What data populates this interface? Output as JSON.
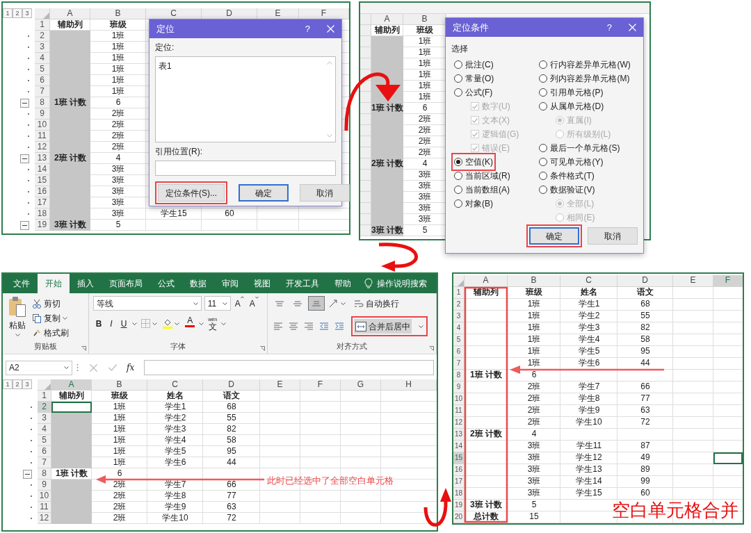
{
  "goto_panel": {
    "outline_levels": [
      "1",
      "2",
      "3"
    ],
    "columns": [
      "A",
      "B",
      "C",
      "D",
      "E",
      "F"
    ],
    "rows": [
      {
        "n": "1",
        "cells": [
          "辅助列",
          "班级"
        ],
        "shaded": false
      },
      {
        "n": "2",
        "cells": [
          "",
          "1班"
        ],
        "shaded": true,
        "group_end": false
      },
      {
        "n": "3",
        "cells": [
          "",
          "1班"
        ],
        "shaded": true,
        "group_end": false
      },
      {
        "n": "4",
        "cells": [
          "",
          "1班"
        ],
        "shaded": true,
        "group_end": false
      },
      {
        "n": "5",
        "cells": [
          "",
          "1班"
        ],
        "shaded": true,
        "group_end": false
      },
      {
        "n": "6",
        "cells": [
          "",
          "1班"
        ],
        "shaded": true,
        "group_end": false
      },
      {
        "n": "7",
        "cells": [
          "",
          "1班"
        ],
        "shaded": true,
        "group_end": false
      },
      {
        "n": "8",
        "cells": [
          "1班 计数",
          "6"
        ],
        "shaded": true,
        "group_end": true
      },
      {
        "n": "9",
        "cells": [
          "",
          "2班"
        ],
        "shaded": true,
        "group_end": false
      },
      {
        "n": "10",
        "cells": [
          "",
          "2班"
        ],
        "shaded": true,
        "group_end": false
      },
      {
        "n": "11",
        "cells": [
          "",
          "2班"
        ],
        "shaded": true,
        "group_end": false
      },
      {
        "n": "12",
        "cells": [
          "",
          "2班"
        ],
        "shaded": true,
        "group_end": false
      },
      {
        "n": "13",
        "cells": [
          "2班 计数",
          "4"
        ],
        "shaded": true,
        "group_end": true
      },
      {
        "n": "14",
        "cells": [
          "",
          "3班"
        ],
        "shaded": true,
        "group_end": false
      },
      {
        "n": "15",
        "cells": [
          "",
          "3班"
        ],
        "shaded": true,
        "group_end": false
      },
      {
        "n": "16",
        "cells": [
          "",
          "3班"
        ],
        "shaded": true,
        "group_end": false
      },
      {
        "n": "17",
        "cells": [
          "",
          "3班"
        ],
        "shaded": true,
        "group_end": false
      },
      {
        "n": "18",
        "cells": [
          "",
          "3班",
          "学生15",
          "60"
        ],
        "shaded": true,
        "group_end": false
      },
      {
        "n": "19",
        "cells": [
          "3班 计数",
          "5"
        ],
        "shaded": true,
        "group_end": true
      }
    ],
    "dialog": {
      "title": "定位",
      "help": "?",
      "location_label": "定位:",
      "list_items": [
        "表1"
      ],
      "reference_label": "引用位置(R):",
      "buttons": [
        {
          "label": "定位条件(S)...",
          "default": false,
          "highlighted": true
        },
        {
          "label": "确定",
          "default": true,
          "highlighted": false
        },
        {
          "label": "取消",
          "default": false,
          "highlighted": false
        }
      ]
    }
  },
  "special_panel": {
    "columns": [
      "A",
      "B"
    ],
    "rows": [
      {
        "cells": [
          "辅助列",
          "班级"
        ],
        "shaded": false
      },
      {
        "cells": [
          "",
          "1班"
        ],
        "shaded": true
      },
      {
        "cells": [
          "",
          "1班"
        ],
        "shaded": true
      },
      {
        "cells": [
          "",
          "1班"
        ],
        "shaded": true
      },
      {
        "cells": [
          "",
          "1班"
        ],
        "shaded": true
      },
      {
        "cells": [
          "",
          "1班"
        ],
        "shaded": true
      },
      {
        "cells": [
          "",
          "1班"
        ],
        "shaded": true
      },
      {
        "cells": [
          "1班 计数",
          "6"
        ],
        "shaded": true
      },
      {
        "cells": [
          "",
          "2班"
        ],
        "shaded": true
      },
      {
        "cells": [
          "",
          "2班"
        ],
        "shaded": true
      },
      {
        "cells": [
          "",
          "2班"
        ],
        "shaded": true
      },
      {
        "cells": [
          "",
          "2班"
        ],
        "shaded": true
      },
      {
        "cells": [
          "2班 计数",
          "4"
        ],
        "shaded": true
      },
      {
        "cells": [
          "",
          "3班"
        ],
        "shaded": true
      },
      {
        "cells": [
          "",
          "3班"
        ],
        "shaded": true
      },
      {
        "cells": [
          "",
          "3班"
        ],
        "shaded": true
      },
      {
        "cells": [
          "",
          "3班"
        ],
        "shaded": true
      },
      {
        "cells": [
          "",
          "3班"
        ],
        "shaded": true
      },
      {
        "cells": [
          "3班 计数",
          "5"
        ],
        "shaded": true
      }
    ],
    "dialog": {
      "title": "定位条件",
      "help": "?",
      "group_label": "选择",
      "columns": [
        [
          {
            "kind": "radio",
            "label": "批注(C)",
            "selected": false
          },
          {
            "kind": "radio",
            "label": "常量(O)",
            "selected": false
          },
          {
            "kind": "radio",
            "label": "公式(F)",
            "selected": false,
            "children": [
              {
                "kind": "checkbox",
                "label": "数字(U)",
                "checked": true,
                "disabled": true
              },
              {
                "kind": "checkbox",
                "label": "文本(X)",
                "checked": true,
                "disabled": true
              },
              {
                "kind": "checkbox",
                "label": "逻辑值(G)",
                "checked": true,
                "disabled": true
              },
              {
                "kind": "checkbox",
                "label": "错误(E)",
                "checked": true,
                "disabled": true
              }
            ]
          },
          {
            "kind": "radio",
            "label": "空值(K)",
            "selected": true,
            "highlighted": true
          },
          {
            "kind": "radio",
            "label": "当前区域(R)",
            "selected": false
          },
          {
            "kind": "radio",
            "label": "当前数组(A)",
            "selected": false
          },
          {
            "kind": "radio",
            "label": "对象(B)",
            "selected": false
          }
        ],
        [
          {
            "kind": "radio",
            "label": "行内容差异单元格(W)",
            "selected": false
          },
          {
            "kind": "radio",
            "label": "列内容差异单元格(M)",
            "selected": false
          },
          {
            "kind": "radio",
            "label": "引用单元格(P)",
            "selected": false
          },
          {
            "kind": "radio",
            "label": "从属单元格(D)",
            "selected": false,
            "children": [
              {
                "kind": "radio",
                "label": "直属(I)",
                "selected": true,
                "disabled": true
              },
              {
                "kind": "radio",
                "label": "所有级别(L)",
                "selected": false,
                "disabled": true
              }
            ]
          },
          {
            "kind": "radio",
            "label": "最后一个单元格(S)",
            "selected": false
          },
          {
            "kind": "radio",
            "label": "可见单元格(Y)",
            "selected": false
          },
          {
            "kind": "radio",
            "label": "条件格式(T)",
            "selected": false
          },
          {
            "kind": "radio",
            "label": "数据验证(V)",
            "selected": false,
            "children": [
              {
                "kind": "radio",
                "label": "全部(L)",
                "selected": true,
                "disabled": true
              },
              {
                "kind": "radio",
                "label": "相同(E)",
                "selected": false,
                "disabled": true
              }
            ]
          }
        ]
      ],
      "buttons": [
        {
          "label": "确定",
          "default": true,
          "highlighted": true
        },
        {
          "label": "取消",
          "default": false,
          "highlighted": false
        }
      ]
    }
  },
  "ribbon_panel": {
    "tabs": [
      {
        "label": "文件",
        "selected": false
      },
      {
        "label": "开始",
        "selected": true
      },
      {
        "label": "插入",
        "selected": false
      },
      {
        "label": "页面布局",
        "selected": false
      },
      {
        "label": "公式",
        "selected": false
      },
      {
        "label": "数据",
        "selected": false
      },
      {
        "label": "审阅",
        "selected": false
      },
      {
        "label": "视图",
        "selected": false
      },
      {
        "label": "开发工具",
        "selected": false
      },
      {
        "label": "帮助",
        "selected": false
      }
    ],
    "search": "操作说明搜索",
    "clipboard": {
      "paste": "粘贴",
      "cut": "剪切",
      "copy": "复制",
      "format_painter": "格式刷",
      "label": "剪贴板"
    },
    "font": {
      "name": "等线",
      "size": "11",
      "grow": "A",
      "shrink": "A",
      "bold": "B",
      "italic": "I",
      "underline": "U",
      "font_color": "A",
      "phonetic_pinyin": "wén",
      "phonetic": "文",
      "label": "字体"
    },
    "alignment": {
      "vertical": [
        {
          "selected": false
        },
        {
          "selected": false
        },
        {
          "selected": true
        }
      ],
      "wrap": "自动换行",
      "merge": "合并后居中",
      "merge_highlighted": true,
      "label": "对齐方式"
    },
    "formula_bar": {
      "name_box": "A2",
      "fx": "fx"
    },
    "sheet": {
      "outline_levels": [
        "1",
        "2",
        "3"
      ],
      "columns": [
        {
          "label": "A",
          "selected": true
        },
        {
          "label": "B",
          "selected": false
        },
        {
          "label": "C",
          "selected": false
        },
        {
          "label": "D",
          "selected": false
        },
        {
          "label": "E",
          "selected": false
        },
        {
          "label": "F",
          "selected": false
        },
        {
          "label": "G",
          "selected": false
        },
        {
          "label": "H",
          "selected": false
        }
      ],
      "rows": [
        {
          "n": "1",
          "cells": [
            "辅助列",
            "班级",
            "姓名",
            "语文"
          ],
          "selected": false
        },
        {
          "n": "2",
          "cells": [
            "",
            "1班",
            "学生1",
            "68"
          ],
          "shaded": false,
          "selected": true,
          "group_end": false
        },
        {
          "n": "3",
          "cells": [
            "",
            "1班",
            "学生2",
            "55"
          ],
          "shaded": true,
          "selected": false,
          "group_end": false
        },
        {
          "n": "4",
          "cells": [
            "",
            "1班",
            "学生3",
            "82"
          ],
          "shaded": true,
          "selected": false,
          "group_end": false
        },
        {
          "n": "5",
          "cells": [
            "",
            "1班",
            "学生4",
            "58"
          ],
          "shaded": true,
          "selected": false,
          "group_end": false
        },
        {
          "n": "6",
          "cells": [
            "",
            "1班",
            "学生5",
            "95"
          ],
          "shaded": true,
          "selected": false,
          "group_end": false
        },
        {
          "n": "7",
          "cells": [
            "",
            "1班",
            "学生6",
            "44"
          ],
          "shaded": true,
          "selected": false,
          "group_end": false
        },
        {
          "n": "8",
          "cells": [
            "1班 计数",
            "6"
          ],
          "shaded": false,
          "selected": false,
          "group_end": true
        },
        {
          "n": "9",
          "cells": [
            "",
            "2班",
            "学生7",
            "66"
          ],
          "shaded": true,
          "selected": false,
          "group_end": false
        },
        {
          "n": "10",
          "cells": [
            "",
            "2班",
            "学生8",
            "77"
          ],
          "shaded": true,
          "selected": false,
          "group_end": false
        },
        {
          "n": "11",
          "cells": [
            "",
            "2班",
            "学生9",
            "63"
          ],
          "shaded": true,
          "selected": false,
          "group_end": false
        },
        {
          "n": "12",
          "cells": [
            "",
            "2班",
            "学生10",
            "72"
          ],
          "shaded": true,
          "selected": false,
          "group_end": false
        }
      ]
    }
  },
  "result_panel": {
    "column_highlighted": true,
    "columns": [
      {
        "label": "A",
        "selected": false
      },
      {
        "label": "B",
        "selected": false
      },
      {
        "label": "C",
        "selected": false
      },
      {
        "label": "D",
        "selected": false
      },
      {
        "label": "E",
        "selected": false
      },
      {
        "label": "F",
        "selected": true
      }
    ],
    "rows": [
      {
        "n": "1",
        "cells": [
          "辅助列",
          "班级",
          "姓名",
          "语文"
        ],
        "selected": false
      },
      {
        "n": "2",
        "cells": [
          "",
          "1班",
          "学生1",
          "68"
        ],
        "selected": false
      },
      {
        "n": "3",
        "cells": [
          "",
          "1班",
          "学生2",
          "55"
        ],
        "selected": false
      },
      {
        "n": "4",
        "cells": [
          "",
          "1班",
          "学生3",
          "82"
        ],
        "selected": false
      },
      {
        "n": "5",
        "cells": [
          "",
          "1班",
          "学生4",
          "58"
        ],
        "selected": false
      },
      {
        "n": "6",
        "cells": [
          "",
          "1班",
          "学生5",
          "95"
        ],
        "selected": false
      },
      {
        "n": "7",
        "cells": [
          "",
          "1班",
          "学生6",
          "44"
        ],
        "selected": false
      },
      {
        "n": "8",
        "cells": [
          "1班 计数",
          "6"
        ],
        "selected": false
      },
      {
        "n": "9",
        "cells": [
          "",
          "2班",
          "学生7",
          "66"
        ],
        "selected": false
      },
      {
        "n": "10",
        "cells": [
          "",
          "2班",
          "学生8",
          "77"
        ],
        "selected": false
      },
      {
        "n": "11",
        "cells": [
          "",
          "2班",
          "学生9",
          "63"
        ],
        "selected": false
      },
      {
        "n": "12",
        "cells": [
          "",
          "2班",
          "学生10",
          "72"
        ],
        "selected": false
      },
      {
        "n": "13",
        "cells": [
          "2班 计数",
          "4"
        ],
        "selected": false
      },
      {
        "n": "14",
        "cells": [
          "",
          "3班",
          "学生11",
          "87"
        ],
        "selected": false
      },
      {
        "n": "15",
        "cells": [
          "",
          "3班",
          "学生12",
          "49"
        ],
        "selected": true
      },
      {
        "n": "16",
        "cells": [
          "",
          "3班",
          "学生13",
          "89"
        ],
        "selected": false
      },
      {
        "n": "17",
        "cells": [
          "",
          "3班",
          "学生14",
          "99"
        ],
        "selected": false
      },
      {
        "n": "18",
        "cells": [
          "",
          "3班",
          "学生15",
          "60"
        ],
        "selected": false
      },
      {
        "n": "19",
        "cells": [
          "3班 计数",
          "5"
        ],
        "selected": false
      },
      {
        "n": "20",
        "cells": [
          "总计数",
          "15"
        ],
        "selected": false
      }
    ]
  },
  "annotations": [
    {
      "kind": "caption",
      "text": "此时已经选中了全部空白单元格"
    },
    {
      "kind": "headline",
      "text": "空白单元格合并"
    }
  ]
}
